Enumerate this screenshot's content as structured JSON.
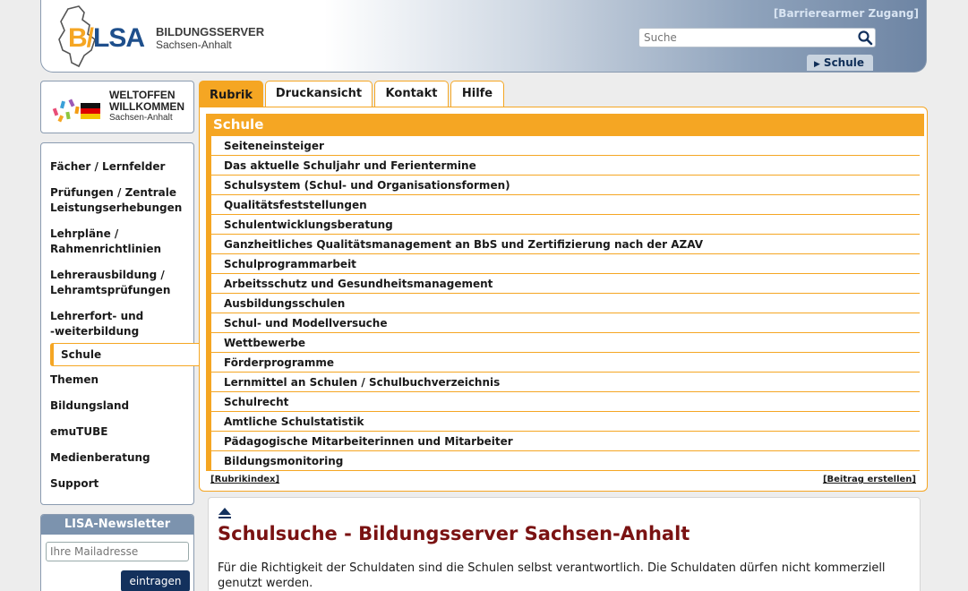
{
  "header": {
    "logo_letter": "B",
    "logo_rest": "LSA",
    "org_name": "BILDUNGSSERVER",
    "org_sub": "Sachsen-Anhalt",
    "accessible_link": "[Barrierearmer Zugang]",
    "search_placeholder": "Suche",
    "breadcrumb": "Schule"
  },
  "welcome": {
    "line1": "WELTOFFEN",
    "line2": "WILLKOMMEN",
    "line3": "Sachsen-Anhalt"
  },
  "nav": {
    "items": [
      {
        "label": "Fächer / Lernfelder"
      },
      {
        "label": "Prüfungen / Zentrale",
        "label2": "Leistungserhebungen"
      },
      {
        "label": "Lehrpläne /",
        "label2": "Rahmenrichtlinien"
      },
      {
        "label": "Lehrerausbildung /",
        "label2": "Lehramtsprüfungen"
      },
      {
        "label": "Lehrerfort- und",
        "label2": "-weiterbildung"
      },
      {
        "label": "Schule"
      },
      {
        "label": "Themen"
      },
      {
        "label": "Bildungsland"
      },
      {
        "label": "emuTUBE"
      },
      {
        "label": "Medienberatung"
      },
      {
        "label": "Support"
      }
    ]
  },
  "newsletter": {
    "title": "LISA-Newsletter",
    "placeholder": "Ihre Mailadresse",
    "button": "eintragen"
  },
  "tabs": [
    {
      "label": "Rubrik"
    },
    {
      "label": "Druckansicht"
    },
    {
      "label": "Kontakt"
    },
    {
      "label": "Hilfe"
    }
  ],
  "section": {
    "title": "Schule",
    "rows": [
      "Seiteneinsteiger",
      "Das aktuelle Schuljahr und Ferientermine",
      "Schulsystem (Schul- und Organisationsformen)",
      "Qualitätsfeststellungen",
      "Schulentwicklungsberatung",
      "Ganzheitliches Qualitätsmanagement an BbS und Zertifizierung nach der AZAV",
      "Schulprogrammarbeit",
      "Arbeitsschutz und Gesundheitsmanagement",
      "Ausbildungsschulen",
      "Schul- und Modellversuche",
      "Wettbewerbe",
      "Förderprogramme",
      "Lernmittel an Schulen / Schulbuchverzeichnis",
      "Schulrecht",
      "Amtliche Schulstatistik",
      "Pädagogische Mitarbeiterinnen und Mitarbeiter",
      "Bildungsmonitoring"
    ],
    "rubrikindex": "[Rubrikindex]",
    "beitrag": "[Beitrag erstellen]"
  },
  "content": {
    "title": "Schulsuche - Bildungsserver Sachsen-Anhalt",
    "text": "Für die Richtigkeit der Schuldaten sind die Schulen selbst verantwortlich. Die Schuldaten dürfen nicht kommerziell genutzt werden."
  },
  "colors": {
    "accent": "#f5a623",
    "navy": "#13315d",
    "title_red": "#7a1212"
  }
}
